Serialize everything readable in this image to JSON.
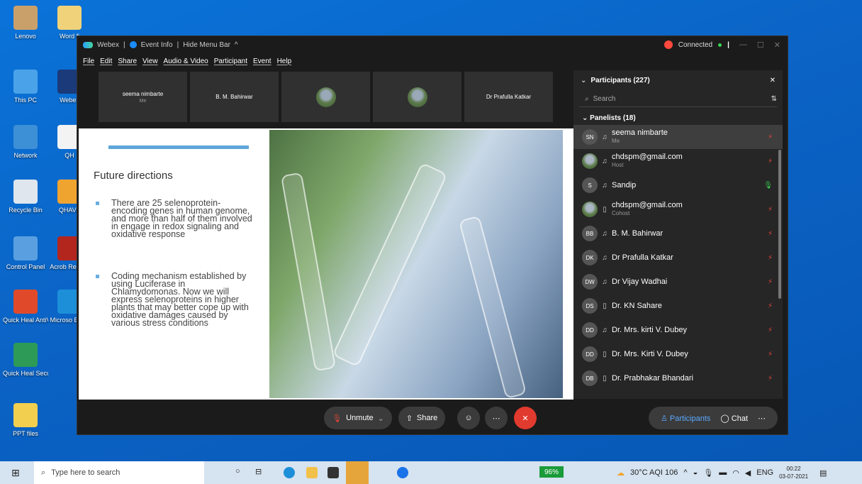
{
  "desktop_icons": [
    {
      "label": "Lenovo"
    },
    {
      "label": "Word fi"
    },
    {
      "label": "This PC"
    },
    {
      "label": "Webex"
    },
    {
      "label": "Network"
    },
    {
      "label": "QH"
    },
    {
      "label": "Recycle Bin"
    },
    {
      "label": "QHAVF"
    },
    {
      "label": "Control Panel"
    },
    {
      "label": "Acrob Reader"
    },
    {
      "label": "Quick Heal AntiVirus Pro"
    },
    {
      "label": "Microso Edge"
    },
    {
      "label": "Quick Heal Secure Br..."
    },
    {
      "label": "PPT files"
    }
  ],
  "title": {
    "app": "Webex",
    "sep": "|",
    "event_info": "Event Info",
    "hide_menu": "Hide Menu Bar",
    "status": "Connected"
  },
  "menu": [
    "File",
    "Edit",
    "Share",
    "View",
    "Audio & Video",
    "Participant",
    "Event",
    "Help"
  ],
  "thumbnails": [
    {
      "name": "seema nimbarte",
      "sub": "Me"
    },
    {
      "name": "B. M. Bahirwar",
      "sub": ""
    },
    {
      "name": "",
      "sub": ""
    },
    {
      "name": "",
      "sub": ""
    },
    {
      "name": "Dr Prafulla Katkar",
      "sub": ""
    }
  ],
  "slide": {
    "heading": "Future directions",
    "bullets": [
      "There are 25 selenoprotein-encoding genes in human genome, and more than half of them involved in engage in redox signaling and oxidative response",
      "Coding mechanism established by using Luciferase in Chlamydomonas. Now we will express selenoproteins in higher plants that may better cope up with oxidative damages caused by various stress conditions"
    ]
  },
  "panel": {
    "title": "Participants (227)",
    "search_placeholder": "Search",
    "group": "Panelists (18)",
    "participants": [
      {
        "initials": "SN",
        "name": "seema nimbarte",
        "role": "Me",
        "mic": "muted"
      },
      {
        "initials": "",
        "name": "chdspm@gmail.com",
        "role": "Host",
        "mic": "muted"
      },
      {
        "initials": "S",
        "name": "Sandip",
        "role": "",
        "mic": "active"
      },
      {
        "initials": "",
        "name": "chdspm@gmail.com",
        "role": "Cohost",
        "mic": "muted"
      },
      {
        "initials": "BB",
        "name": "B. M. Bahirwar",
        "role": "",
        "mic": "muted"
      },
      {
        "initials": "DK",
        "name": "Dr Prafulla Katkar",
        "role": "",
        "mic": "muted"
      },
      {
        "initials": "DW",
        "name": "Dr Vijay Wadhai",
        "role": "",
        "mic": "muted"
      },
      {
        "initials": "DS",
        "name": "Dr. KN Sahare",
        "role": "",
        "mic": "muted"
      },
      {
        "initials": "DD",
        "name": "Dr. Mrs. kirti V. Dubey",
        "role": "",
        "mic": "muted"
      },
      {
        "initials": "DD",
        "name": "Dr. Mrs. Kirti V. Dubey",
        "role": "",
        "mic": "muted"
      },
      {
        "initials": "DB",
        "name": "Dr. Prabhakar Bhandari",
        "role": "",
        "mic": "muted"
      }
    ]
  },
  "controls": {
    "unmute": "Unmute",
    "share": "Share",
    "participants_tab": "Participants",
    "chat_tab": "Chat"
  },
  "taskbar": {
    "search_placeholder": "Type here to search",
    "battery": "96%",
    "weather": "30°C AQI 106",
    "lang": "ENG",
    "time": "00:22",
    "date": "03-07-2021"
  },
  "colors": {
    "accent": "#1a8cff",
    "end_call": "#e13a2e",
    "muted_mic": "#e0463a",
    "active_mic": "#39d353"
  }
}
